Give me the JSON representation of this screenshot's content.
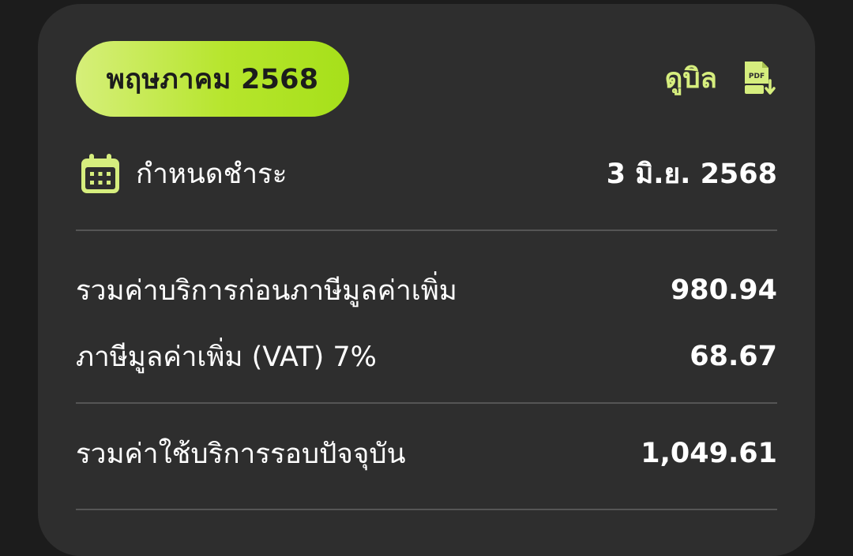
{
  "bill": {
    "month_label": "พฤษภาคม 2568",
    "view_bill_label": "ดูบิล",
    "pdf_icon_text": "PDF",
    "due": {
      "label": "กำหนดชำระ",
      "value": "3 มิ.ย. 2568"
    },
    "lines": [
      {
        "label": "รวมค่าบริการก่อนภาษีมูลค่าเพิ่ม",
        "value": "980.94"
      },
      {
        "label": "ภาษีมูลค่าเพิ่ม (VAT) 7%",
        "value": "68.67"
      }
    ],
    "total": {
      "label": "รวมค่าใช้บริการรอบปัจจุบัน",
      "value": "1,049.61"
    }
  },
  "colors": {
    "background": "#1c1c1c",
    "card": "#2e2e2e",
    "accent": "#d6ee7e",
    "pill_gradient_start": "#d6ef7a",
    "pill_gradient_end": "#a6e01a",
    "divider": "#555555",
    "text": "#ffffff"
  },
  "icons": {
    "pdf": "pdf-download-icon",
    "due": "calendar-icon"
  }
}
